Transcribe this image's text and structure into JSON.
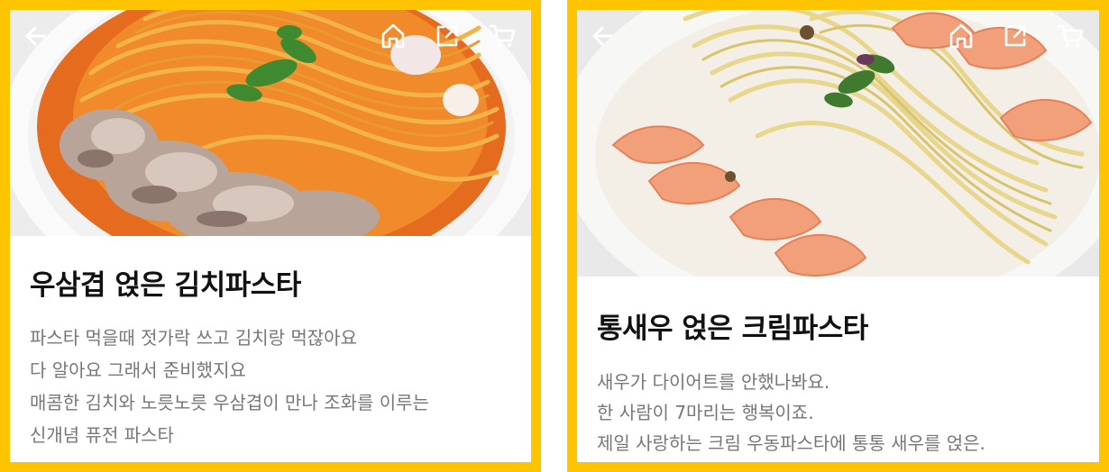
{
  "cards": [
    {
      "title": "우삼겹 얹은 김치파스타",
      "description_lines": [
        "파스타 먹을때 젓가락 쓰고 김치랑 먹잖아요",
        "다 알아요 그래서 준비했지요",
        "매콤한 김치와 노릇노릇 우삼겹이 만나 조화를 이루는",
        "신개념 퓨전 파스타"
      ],
      "image_icon": "kimchi-pasta-photo"
    },
    {
      "title": "통새우 얹은 크림파스타",
      "description_lines": [
        "새우가 다이어트를 안했나봐요.",
        "한 사람이 7마리는 행복이죠.",
        "제일 사랑하는 크림 우동파스타에 통통 새우를 얹은."
      ],
      "image_icon": "cream-shrimp-pasta-photo"
    }
  ],
  "topbar_icons": [
    "back-arrow-icon",
    "home-icon",
    "share-icon",
    "cart-icon"
  ],
  "colors": {
    "frame": "#FFC400",
    "title": "#111111",
    "description": "#777777"
  }
}
